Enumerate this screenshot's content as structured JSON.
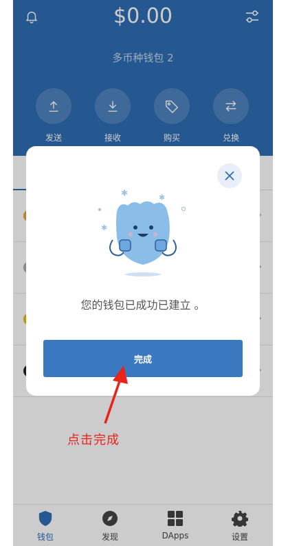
{
  "header": {
    "balance": "$0.00",
    "wallet_name": "多币种钱包 2"
  },
  "actions": [
    {
      "label": "发送",
      "icon": "upload-icon"
    },
    {
      "label": "接收",
      "icon": "download-icon"
    },
    {
      "label": "购买",
      "icon": "tag-icon"
    },
    {
      "label": "兑换",
      "icon": "swap-icon"
    }
  ],
  "bottom_nav": [
    {
      "label": "钱包",
      "icon": "shield-icon"
    },
    {
      "label": "发现",
      "icon": "compass-icon"
    },
    {
      "label": "DApps",
      "icon": "grid-icon"
    },
    {
      "label": "设置",
      "icon": "gear-icon"
    }
  ],
  "dialog": {
    "message": "您的钱包已成功已建立 。",
    "button_label": "完成"
  },
  "annotation": {
    "text": "点击完成"
  },
  "colors": {
    "header_blue": "#2f6fb4",
    "button_blue": "#3a78bf",
    "annotation_red": "#e8231c"
  }
}
